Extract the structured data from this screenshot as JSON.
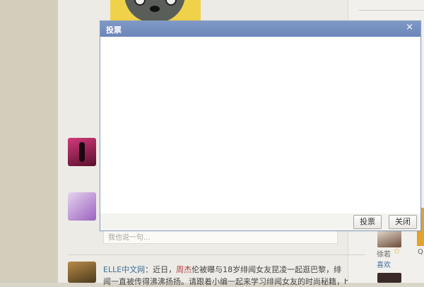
{
  "dialog": {
    "title": "投票",
    "close_glyph": "×",
    "report_label": "投票",
    "close_label": "关闭"
  },
  "comment": {
    "placeholder": "我也说一句..."
  },
  "feed": {
    "source": "ELLE中文网",
    "separator": "：",
    "text_before": "近日，",
    "highlight": "周杰",
    "text_after": "伦被曝与18岁绯闻女友昆凌一起逛巴黎，绯",
    "line2": "闻一直被传得沸沸扬扬。请跟着小编一起来学习绯闻女友的时尚秘籍，h"
  },
  "right": {
    "name": "徐若",
    "star_glyph": "☆",
    "like": "喜欢",
    "edge_letter": "Q"
  }
}
